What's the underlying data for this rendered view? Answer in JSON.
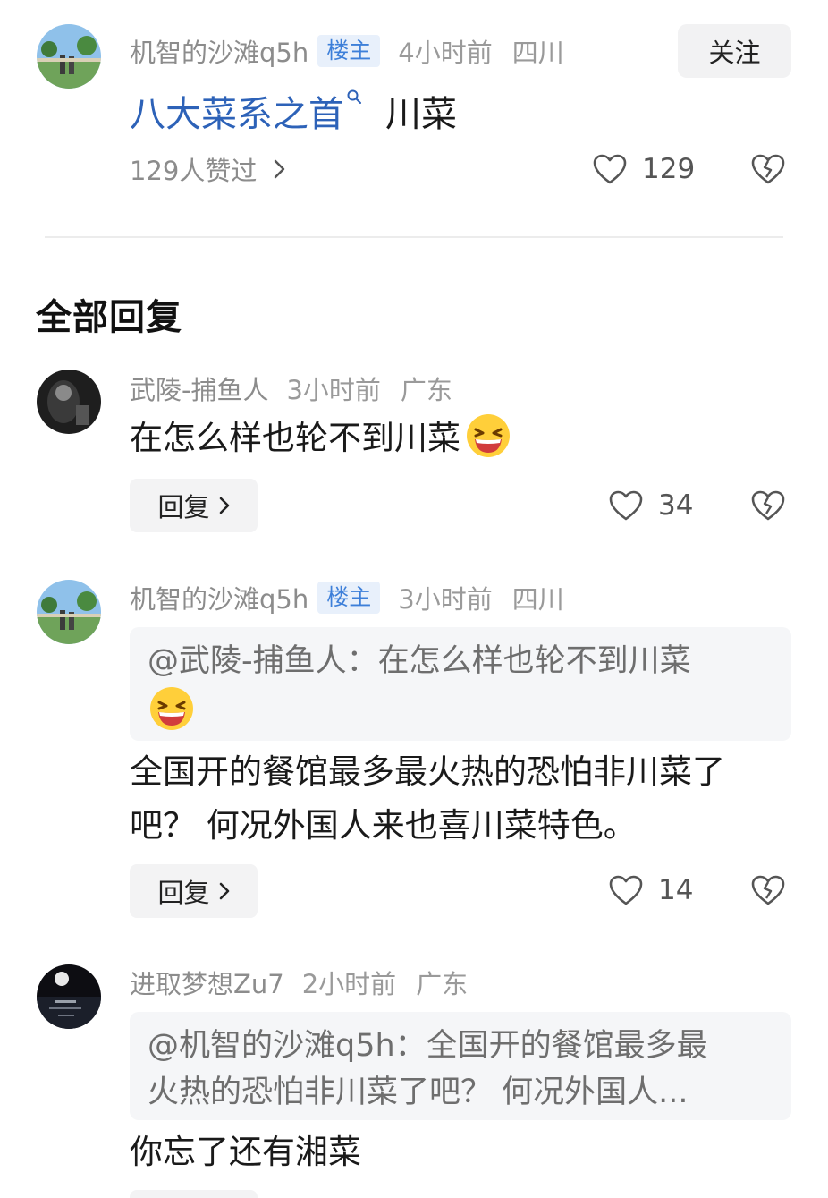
{
  "post": {
    "author": "机智的沙滩q5h",
    "badge": "楼主",
    "time": "4小时前",
    "region": "四川",
    "follow_label": "关注",
    "topic_link": "八大菜系之首",
    "text": "川菜",
    "liked_by": "129人赞过",
    "like_count": "129"
  },
  "section_title": "全部回复",
  "replies": [
    {
      "author": "武陵-捕鱼人",
      "time": "3小时前",
      "region": "广东",
      "text": "在怎么样也轮不到川菜",
      "emoji": "laughing-face-emoji",
      "reply_label": "回复",
      "like_count": "34"
    },
    {
      "author": "机智的沙滩q5h",
      "badge": "楼主",
      "time": "3小时前",
      "region": "四川",
      "quote": "@武陵-捕鱼人：在怎么样也轮不到川菜",
      "quote_emoji": "laughing-face-emoji",
      "text_line1": "全国开的餐馆最多最火热的恐怕非川菜了",
      "text_line2": "吧？ 何况外国人来也喜川菜特色。",
      "reply_label": "回复",
      "like_count": "14"
    },
    {
      "author": "进取梦想Zu7",
      "time": "2小时前",
      "region": "广东",
      "quote_line1": "@机智的沙滩q5h：全国开的餐馆最多最",
      "quote_line2": "火热的恐怕非川菜了吧？ 何况外国人...",
      "text": "你忘了还有湘菜"
    }
  ],
  "colors": {
    "link": "#2d62b8",
    "badge_bg": "#e8f0fb",
    "badge_text": "#3d7fd9",
    "meta_text": "#8c8c8c"
  }
}
